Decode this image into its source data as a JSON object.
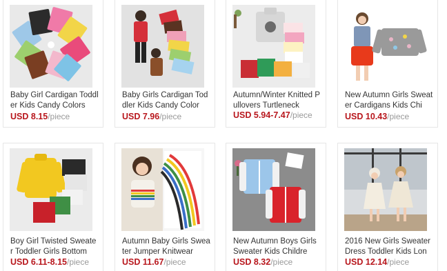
{
  "products": [
    {
      "title": "Baby Girl Cardigan Toddler Kids Candy Colors",
      "price": "USD 8.15",
      "unit": "/piece",
      "thumb": "candy-cardigans-fan"
    },
    {
      "title": "Baby Girls Cardigan Toddler Kids Candy Color",
      "price": "USD 7.96",
      "unit": "/piece",
      "thumb": "kids-with-cardigans"
    },
    {
      "title": "Autumn/Winter Knitted Pullovers Turtleneck",
      "price": "USD 5.94-7.47",
      "unit": "/piece",
      "thumb": "turtleneck-pullovers"
    },
    {
      "title": "New Autumn Girls Sweater Cardigans Kids Chi",
      "price": "USD 10.43",
      "unit": "/piece",
      "thumb": "girl-grey-cardigan"
    },
    {
      "title": "Boy Girl Twisted Sweater Toddler Girls Bottom",
      "price": "USD 6.11-8.15",
      "unit": "/piece",
      "thumb": "twisted-sweaters"
    },
    {
      "title": "Autumn Baby Girls Sweater Jumper Knitwear",
      "price": "USD 11.67",
      "unit": "/piece",
      "thumb": "rainbow-sweater"
    },
    {
      "title": "New Autumn Boys Girls Sweater Kids Childre",
      "price": "USD 8.32",
      "unit": "/piece",
      "thumb": "baseball-cardigans"
    },
    {
      "title": "2016 New Girls Sweater Dress Toddler Kids Lon",
      "price": "USD 12.14",
      "unit": "/piece",
      "thumb": "sweater-dress-girls"
    }
  ]
}
